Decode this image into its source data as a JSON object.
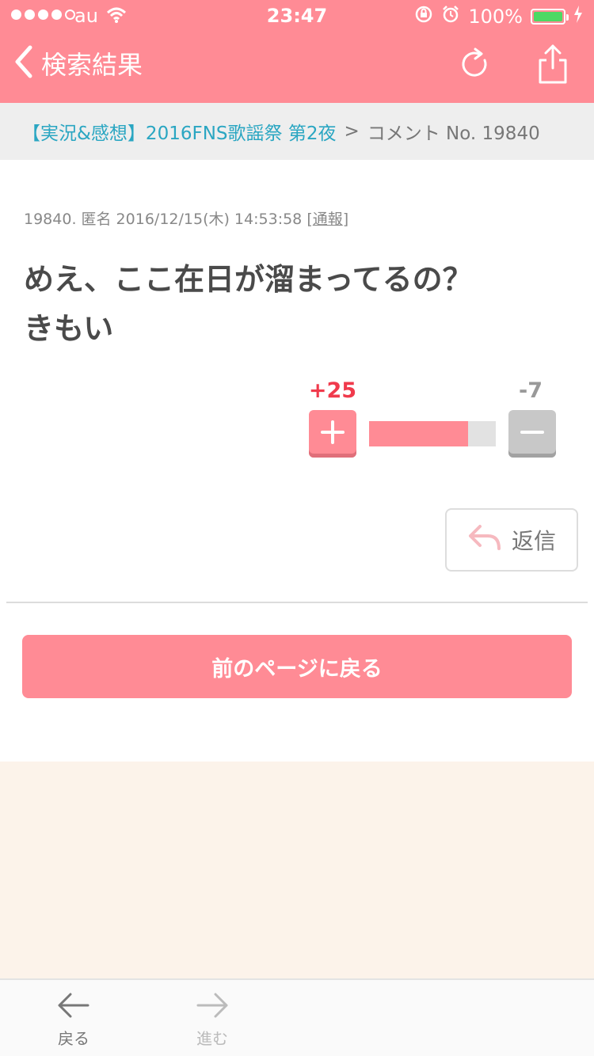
{
  "status_bar": {
    "carrier": "au",
    "time": "23:47",
    "battery": "100%"
  },
  "header": {
    "back_label": "検索結果"
  },
  "breadcrumb": {
    "topic": "【実況&感想】2016FNS歌謡祭 第2夜",
    "separator": ">",
    "current": "コメント No. 19840"
  },
  "comment": {
    "meta": "19840. 匿名 2016/12/15(木) 14:53:58 ",
    "report_open": "[",
    "report_label": "通報",
    "report_close": "]",
    "line1": "めえ、ここ在日が溜まってるの？",
    "line2": "きもい",
    "plus_count": "+25",
    "minus_count": "-7",
    "plus_ratio": 0.78
  },
  "reply_label": "返信",
  "prev_page_label": "前のページに戻る",
  "toolbar": {
    "back_label": "戻る",
    "forward_label": "進む"
  },
  "colors": {
    "accent": "#ff8b95",
    "link": "#2aa6c2",
    "plus_text": "#f03a4c"
  }
}
